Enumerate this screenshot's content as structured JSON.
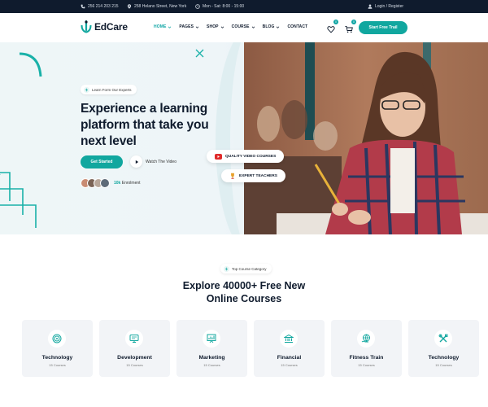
{
  "topbar": {
    "phone": "256 214 203 215",
    "address": "258 Helano Street, New York",
    "hours": "Mon - Sat: 8:00 - 15:00",
    "login": "Login / Register"
  },
  "header": {
    "logo_text": "EdCare",
    "nav": [
      "HOME",
      "PAGES",
      "SHOP",
      "COURSE",
      "BLOG",
      "CONTACT"
    ],
    "wishlist_count": "0",
    "cart_count": "0",
    "cta_label": "Start Free Trail"
  },
  "hero": {
    "tag": "Learn Form Our Experts",
    "title_lines": [
      "Experience a learning",
      "platform that take you",
      "next level"
    ],
    "get_started": "Get Started",
    "watch": "Watch The Video",
    "enrolment_count": "10k",
    "enrolment_label": "Enrolment",
    "float_video": "QUALITY VIDEO COURSES",
    "float_teachers": "EXPERT TEACHERS"
  },
  "courses": {
    "tag": "Top Course Category",
    "title_lines": [
      "Explore 40000+ Free New",
      "Online Courses"
    ],
    "categories": [
      {
        "name": "Technology",
        "count": "15 Courses",
        "icon": "target-icon"
      },
      {
        "name": "Development",
        "count": "15 Courses",
        "icon": "monitor-icon"
      },
      {
        "name": "Marketing",
        "count": "15 Courses",
        "icon": "chart-board-icon"
      },
      {
        "name": "Financial",
        "count": "15 Courses",
        "icon": "bank-icon"
      },
      {
        "name": "Fitness Train",
        "count": "15 Courses",
        "icon": "globe-hand-icon"
      },
      {
        "name": "Technology",
        "count": "15 Courses",
        "icon": "tools-icon"
      }
    ]
  },
  "colors": {
    "accent": "#11a79f",
    "dark": "#0f1b2d",
    "hero_bg": "#eef6f7"
  }
}
